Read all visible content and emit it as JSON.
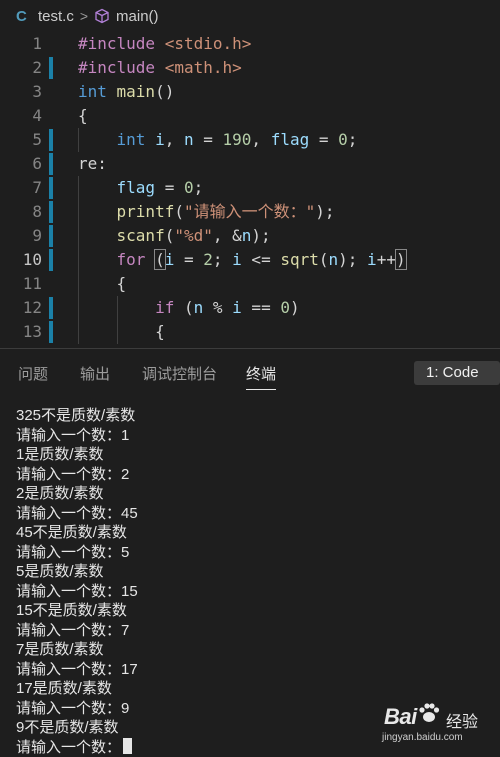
{
  "breadcrumb": {
    "file_icon": "C",
    "file": "test.c",
    "separator": ">",
    "symbol": "main()"
  },
  "editor": {
    "lines": [
      {
        "n": "1",
        "tokens": [
          {
            "t": "#include ",
            "c": "pp"
          },
          {
            "t": "<stdio.h>",
            "c": "inc"
          }
        ]
      },
      {
        "n": "2",
        "tokens": [
          {
            "t": "#include ",
            "c": "pp"
          },
          {
            "t": "<math.h>",
            "c": "inc"
          }
        ]
      },
      {
        "n": "3",
        "tokens": [
          {
            "t": "int ",
            "c": "type"
          },
          {
            "t": "main",
            "c": "fn"
          },
          {
            "t": "()",
            "c": "op"
          }
        ]
      },
      {
        "n": "4",
        "tokens": [
          {
            "t": "{",
            "c": "op"
          }
        ]
      },
      {
        "n": "5",
        "tokens": [
          {
            "t": "    ",
            "c": "op"
          },
          {
            "t": "int ",
            "c": "type"
          },
          {
            "t": "i",
            "c": "var"
          },
          {
            "t": ", ",
            "c": "op"
          },
          {
            "t": "n",
            "c": "var"
          },
          {
            "t": " = ",
            "c": "op"
          },
          {
            "t": "190",
            "c": "num"
          },
          {
            "t": ", ",
            "c": "op"
          },
          {
            "t": "flag",
            "c": "var"
          },
          {
            "t": " = ",
            "c": "op"
          },
          {
            "t": "0",
            "c": "num"
          },
          {
            "t": ";",
            "c": "op"
          }
        ]
      },
      {
        "n": "6",
        "tokens": [
          {
            "t": "re:",
            "c": "op"
          }
        ]
      },
      {
        "n": "7",
        "tokens": [
          {
            "t": "    ",
            "c": "op"
          },
          {
            "t": "flag",
            "c": "var"
          },
          {
            "t": " = ",
            "c": "op"
          },
          {
            "t": "0",
            "c": "num"
          },
          {
            "t": ";",
            "c": "op"
          }
        ]
      },
      {
        "n": "8",
        "tokens": [
          {
            "t": "    ",
            "c": "op"
          },
          {
            "t": "printf",
            "c": "fn"
          },
          {
            "t": "(",
            "c": "op"
          },
          {
            "t": "\"请输入一个数：\"",
            "c": "str"
          },
          {
            "t": ");",
            "c": "op"
          }
        ]
      },
      {
        "n": "9",
        "tokens": [
          {
            "t": "    ",
            "c": "op"
          },
          {
            "t": "scanf",
            "c": "fn"
          },
          {
            "t": "(",
            "c": "op"
          },
          {
            "t": "\"%d\"",
            "c": "str"
          },
          {
            "t": ", &",
            "c": "op"
          },
          {
            "t": "n",
            "c": "var"
          },
          {
            "t": ");",
            "c": "op"
          }
        ]
      },
      {
        "n": "10",
        "active": true,
        "tokens": [
          {
            "t": "    ",
            "c": "op"
          },
          {
            "t": "for ",
            "c": "kw"
          },
          {
            "t": "(",
            "c": "op",
            "br": true
          },
          {
            "t": "i",
            "c": "var"
          },
          {
            "t": " = ",
            "c": "op"
          },
          {
            "t": "2",
            "c": "num"
          },
          {
            "t": "; ",
            "c": "op"
          },
          {
            "t": "i",
            "c": "var"
          },
          {
            "t": " <= ",
            "c": "op"
          },
          {
            "t": "sqrt",
            "c": "fn"
          },
          {
            "t": "(",
            "c": "op"
          },
          {
            "t": "n",
            "c": "var"
          },
          {
            "t": "); ",
            "c": "op"
          },
          {
            "t": "i",
            "c": "var"
          },
          {
            "t": "++",
            "c": "op"
          },
          {
            "t": ")",
            "c": "op",
            "br": true
          }
        ]
      },
      {
        "n": "11",
        "tokens": [
          {
            "t": "    ",
            "c": "op"
          },
          {
            "t": "{",
            "c": "op"
          }
        ]
      },
      {
        "n": "12",
        "tokens": [
          {
            "t": "        ",
            "c": "op"
          },
          {
            "t": "if ",
            "c": "kw"
          },
          {
            "t": "(",
            "c": "op"
          },
          {
            "t": "n",
            "c": "var"
          },
          {
            "t": " % ",
            "c": "op"
          },
          {
            "t": "i",
            "c": "var"
          },
          {
            "t": " == ",
            "c": "op"
          },
          {
            "t": "0",
            "c": "num"
          },
          {
            "t": ")",
            "c": "op"
          }
        ]
      },
      {
        "n": "13",
        "tokens": [
          {
            "t": "        ",
            "c": "op"
          },
          {
            "t": "{",
            "c": "op"
          }
        ]
      }
    ],
    "modified_lines": [
      "2",
      "5",
      "6",
      "7",
      "8",
      "9",
      "10",
      "12",
      "13"
    ]
  },
  "panel": {
    "tabs": [
      {
        "label": "问题",
        "active": false
      },
      {
        "label": "输出",
        "active": false
      },
      {
        "label": "调试控制台",
        "active": false
      },
      {
        "label": "终端",
        "active": true
      }
    ],
    "terminal_select": "1: Code"
  },
  "terminal": {
    "lines": [
      "325不是质数/素数",
      "请输入一个数：1",
      "1是质数/素数",
      "请输入一个数：2",
      "2是质数/素数",
      "请输入一个数：45",
      "45不是质数/素数",
      "请输入一个数：5",
      "5是质数/素数",
      "请输入一个数：15",
      "15不是质数/素数",
      "请输入一个数：7",
      "7是质数/素数",
      "请输入一个数：17",
      "17是质数/素数",
      "请输入一个数：9",
      "9不是质数/素数"
    ],
    "prompt": "请输入一个数："
  },
  "watermark": {
    "logo": "Bai",
    "logo_suffix": "经验",
    "url": "jingyan.baidu.com"
  },
  "colors": {
    "background": "#1e1e1e",
    "modified_marker": "#1b81a8",
    "keyword": "#c586c0",
    "type": "#569cd6",
    "function": "#dcdcaa",
    "variable": "#9cdcfe",
    "number": "#b5cea8",
    "string": "#ce9178"
  }
}
